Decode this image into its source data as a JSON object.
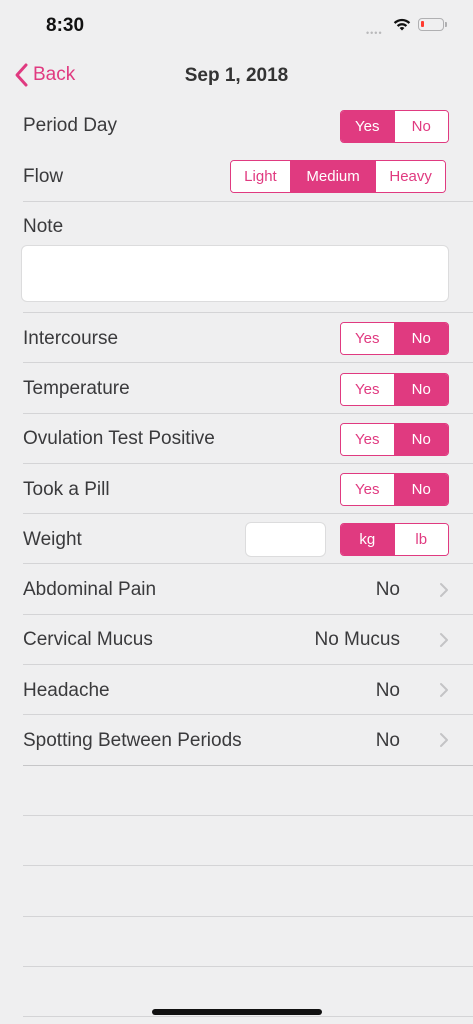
{
  "status_bar": {
    "time": "8:30",
    "signal": "••••",
    "icons": [
      "wifi-icon",
      "battery-icon"
    ]
  },
  "nav": {
    "back_label": "Back",
    "title": "Sep 1, 2018"
  },
  "colors": {
    "accent": "#e03a80",
    "background": "#efeff0"
  },
  "period_day": {
    "label": "Period Day",
    "options": [
      "Yes",
      "No"
    ],
    "selected": "Yes"
  },
  "flow": {
    "label": "Flow",
    "options": [
      "Light",
      "Medium",
      "Heavy"
    ],
    "selected": "Medium"
  },
  "note": {
    "label": "Note",
    "value": ""
  },
  "intercourse": {
    "label": "Intercourse",
    "options": [
      "Yes",
      "No"
    ],
    "selected": "No"
  },
  "temperature": {
    "label": "Temperature",
    "options": [
      "Yes",
      "No"
    ],
    "selected": "No"
  },
  "ovulation": {
    "label": "Ovulation Test Positive",
    "options": [
      "Yes",
      "No"
    ],
    "selected": "No"
  },
  "pill": {
    "label": "Took a Pill",
    "options": [
      "Yes",
      "No"
    ],
    "selected": "No"
  },
  "weight": {
    "label": "Weight",
    "value": "",
    "units": [
      "kg",
      "lb"
    ],
    "selected_unit": "kg"
  },
  "details": [
    {
      "label": "Abdominal Pain",
      "value": "No"
    },
    {
      "label": "Cervical Mucus",
      "value": "No Mucus"
    },
    {
      "label": "Headache",
      "value": "No"
    },
    {
      "label": "Spotting Between Periods",
      "value": "No"
    }
  ]
}
